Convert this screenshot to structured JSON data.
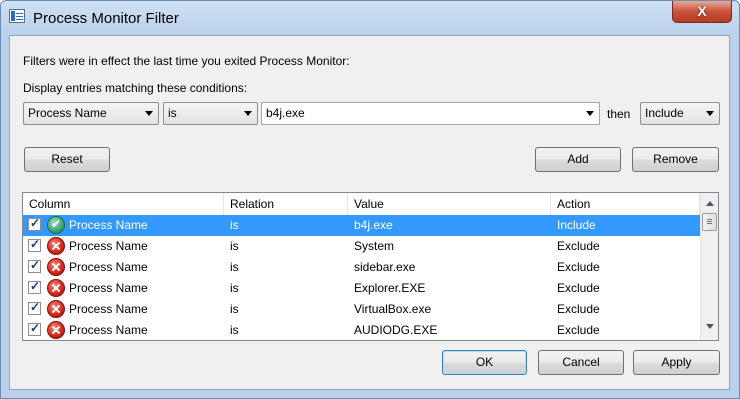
{
  "window": {
    "title": "Process Monitor Filter",
    "close_glyph": "X"
  },
  "intro_text": "Filters were in effect the last time you exited Process Monitor:",
  "conditions_label": "Display entries matching these conditions:",
  "filter_editor": {
    "column_value": "Process Name",
    "relation_value": "is",
    "value_input": "b4j.exe",
    "then_label": "then",
    "action_value": "Include"
  },
  "buttons": {
    "reset": "Reset",
    "add": "Add",
    "remove": "Remove",
    "ok": "OK",
    "cancel": "Cancel",
    "apply": "Apply"
  },
  "table": {
    "headers": [
      "Column",
      "Relation",
      "Value",
      "Action"
    ],
    "rows": [
      {
        "checked": true,
        "status_icon": "include-check-icon",
        "column": "Process Name",
        "relation": "is",
        "value": "b4j.exe",
        "action": "Include",
        "selected": true
      },
      {
        "checked": true,
        "status_icon": "exclude-x-icon",
        "column": "Process Name",
        "relation": "is",
        "value": "System",
        "action": "Exclude"
      },
      {
        "checked": true,
        "status_icon": "exclude-x-icon",
        "column": "Process Name",
        "relation": "is",
        "value": "sidebar.exe",
        "action": "Exclude"
      },
      {
        "checked": true,
        "status_icon": "exclude-x-icon",
        "column": "Process Name",
        "relation": "is",
        "value": "Explorer.EXE",
        "action": "Exclude"
      },
      {
        "checked": true,
        "status_icon": "exclude-x-icon",
        "column": "Process Name",
        "relation": "is",
        "value": "VirtualBox.exe",
        "action": "Exclude"
      },
      {
        "checked": true,
        "status_icon": "exclude-x-icon",
        "column": "Process Name",
        "relation": "is",
        "value": "AUDIODG.EXE",
        "action": "Exclude"
      }
    ]
  },
  "colors": {
    "selection": "#3399ff",
    "dialog_bg": "#f0f0f0",
    "frame": "#b9d1ea",
    "close_button": "#c7523a"
  }
}
